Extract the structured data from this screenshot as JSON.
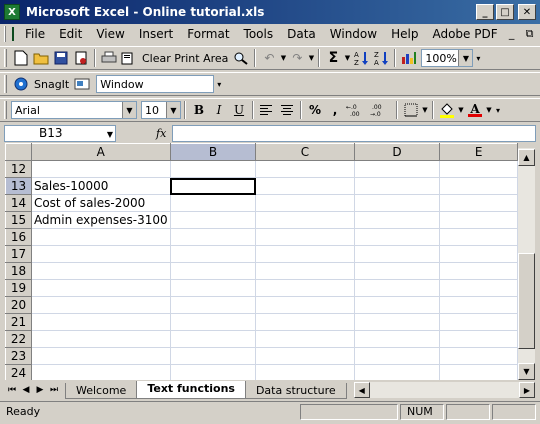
{
  "window": {
    "title": "Microsoft Excel - Online tutorial.xls",
    "app_icon": "X",
    "minimize": "_",
    "restore": "□",
    "close": "✕"
  },
  "menubar": {
    "items": [
      "File",
      "Edit",
      "View",
      "Insert",
      "Format",
      "Tools",
      "Data",
      "Window",
      "Help",
      "Adobe PDF"
    ],
    "controls": [
      "_",
      "⧉",
      "✕"
    ]
  },
  "toolbar1": {
    "clear_print_area": "Clear Print Area",
    "sigma": "Σ",
    "zoom": "100%"
  },
  "toolbar2": {
    "snagit": "SnagIt",
    "window": "Window"
  },
  "format_toolbar": {
    "font_name": "Arial",
    "font_size": "10",
    "bold": "B",
    "italic": "I",
    "underline": "U",
    "percent": "%",
    "comma": ",",
    "inc_decimal": "+.0 .00",
    "dec_decimal": ".00 +.0",
    "font_color_letter": "A"
  },
  "formula_bar": {
    "name_box": "B13",
    "fx": "fx",
    "content": ""
  },
  "grid": {
    "columns": [
      "A",
      "B",
      "C",
      "D",
      "E"
    ],
    "selected_column": "B",
    "active_cell": "B13",
    "rows": [
      {
        "num": "12",
        "a": ""
      },
      {
        "num": "13",
        "a": "Sales-10000"
      },
      {
        "num": "14",
        "a": "Cost of sales-2000"
      },
      {
        "num": "15",
        "a": "Admin expenses-3100"
      },
      {
        "num": "16",
        "a": ""
      },
      {
        "num": "17",
        "a": ""
      },
      {
        "num": "18",
        "a": ""
      },
      {
        "num": "19",
        "a": ""
      },
      {
        "num": "20",
        "a": ""
      },
      {
        "num": "21",
        "a": ""
      },
      {
        "num": "22",
        "a": ""
      },
      {
        "num": "23",
        "a": ""
      },
      {
        "num": "24",
        "a": ""
      }
    ]
  },
  "sheet_tabs": {
    "tabs": [
      "Welcome",
      "Text functions",
      "Data structure"
    ],
    "active": "Text functions"
  },
  "status": {
    "ready": "Ready",
    "num": "NUM"
  }
}
